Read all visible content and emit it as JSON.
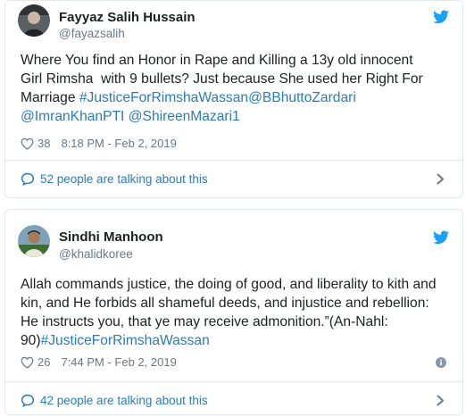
{
  "tweets": [
    {
      "name": "Fayyaz Salih Hussain",
      "handle": "@fayazsalih",
      "text_lines": [
        [
          {
            "t": "Where You find an Honor in Rape and Killing a 13y old innocent"
          }
        ],
        [
          {
            "t": "Girl Rimsha  with 9 bullets? Just because She used her Right For"
          }
        ],
        [
          {
            "t": "Marriage "
          },
          {
            "t": "#JusticeForRimshaWassan",
            "link": true
          },
          {
            "t": "@BBhuttoZardari",
            "link": true
          }
        ],
        [
          {
            "t": "@ImranKhanPTI",
            "link": true
          },
          {
            "t": " "
          },
          {
            "t": "@ShireenMazari1",
            "link": true
          }
        ]
      ],
      "likes": "38",
      "timestamp": "8:18 PM - Feb 2, 2019",
      "talking": "52 people are talking about this"
    },
    {
      "name": "Sindhi Manhoon",
      "handle": "@khalidkoree",
      "text_lines": [
        [
          {
            "t": "Allah commands justice, the doing of good, and liberality to kith and"
          }
        ],
        [
          {
            "t": "kin, and He forbids all shameful deeds, and injustice and rebellion:"
          }
        ],
        [
          {
            "t": "He instructs you, that ye may receive admonition.”(An-Nahl:"
          }
        ],
        [
          {
            "t": "90)"
          },
          {
            "t": "#JusticeForRimshaWassan",
            "link": true
          }
        ]
      ],
      "likes": "26",
      "timestamp": "7:44 PM - Feb 2, 2019",
      "talking": "42 people are talking about this"
    }
  ],
  "icons": {
    "brand": "twitter-bird-icon",
    "like": "heart-icon",
    "conversation": "speech-bubble-icon",
    "more": "chevron-right-icon",
    "info": "info-icon"
  },
  "colors": {
    "accent": "#1da1f2",
    "link": "#2b7bb9",
    "muted": "#697882",
    "text": "#1c2022",
    "border": "#e1e8ed"
  }
}
